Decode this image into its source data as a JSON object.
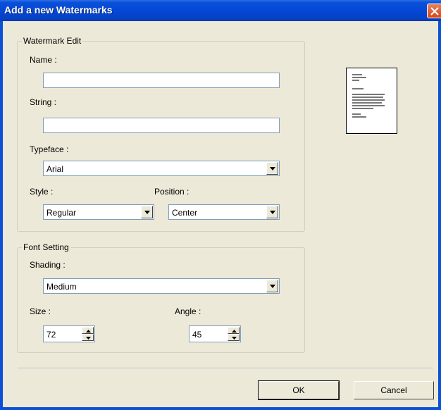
{
  "window": {
    "title": "Add a new Watermarks"
  },
  "watermark_edit": {
    "legend": "Watermark Edit",
    "name_label": "Name :",
    "name_value": "",
    "string_label": "String :",
    "string_value": "",
    "typeface_label": "Typeface :",
    "typeface_value": "Arial",
    "style_label": "Style :",
    "style_value": "Regular",
    "position_label": "Position :",
    "position_value": "Center"
  },
  "font_setting": {
    "legend": "Font Setting",
    "shading_label": "Shading :",
    "shading_value": "Medium",
    "size_label": "Size :",
    "size_value": "72",
    "angle_label": "Angle :",
    "angle_value": "45"
  },
  "buttons": {
    "ok": "OK",
    "cancel": "Cancel"
  },
  "colors": {
    "title_bar": "#0348d6",
    "dialog_bg": "#ece9d8",
    "close_button": "#d7461a"
  },
  "icons": [
    "close-icon",
    "dropdown-arrow-icon",
    "spin-up-icon",
    "spin-down-icon",
    "document-preview-icon"
  ]
}
